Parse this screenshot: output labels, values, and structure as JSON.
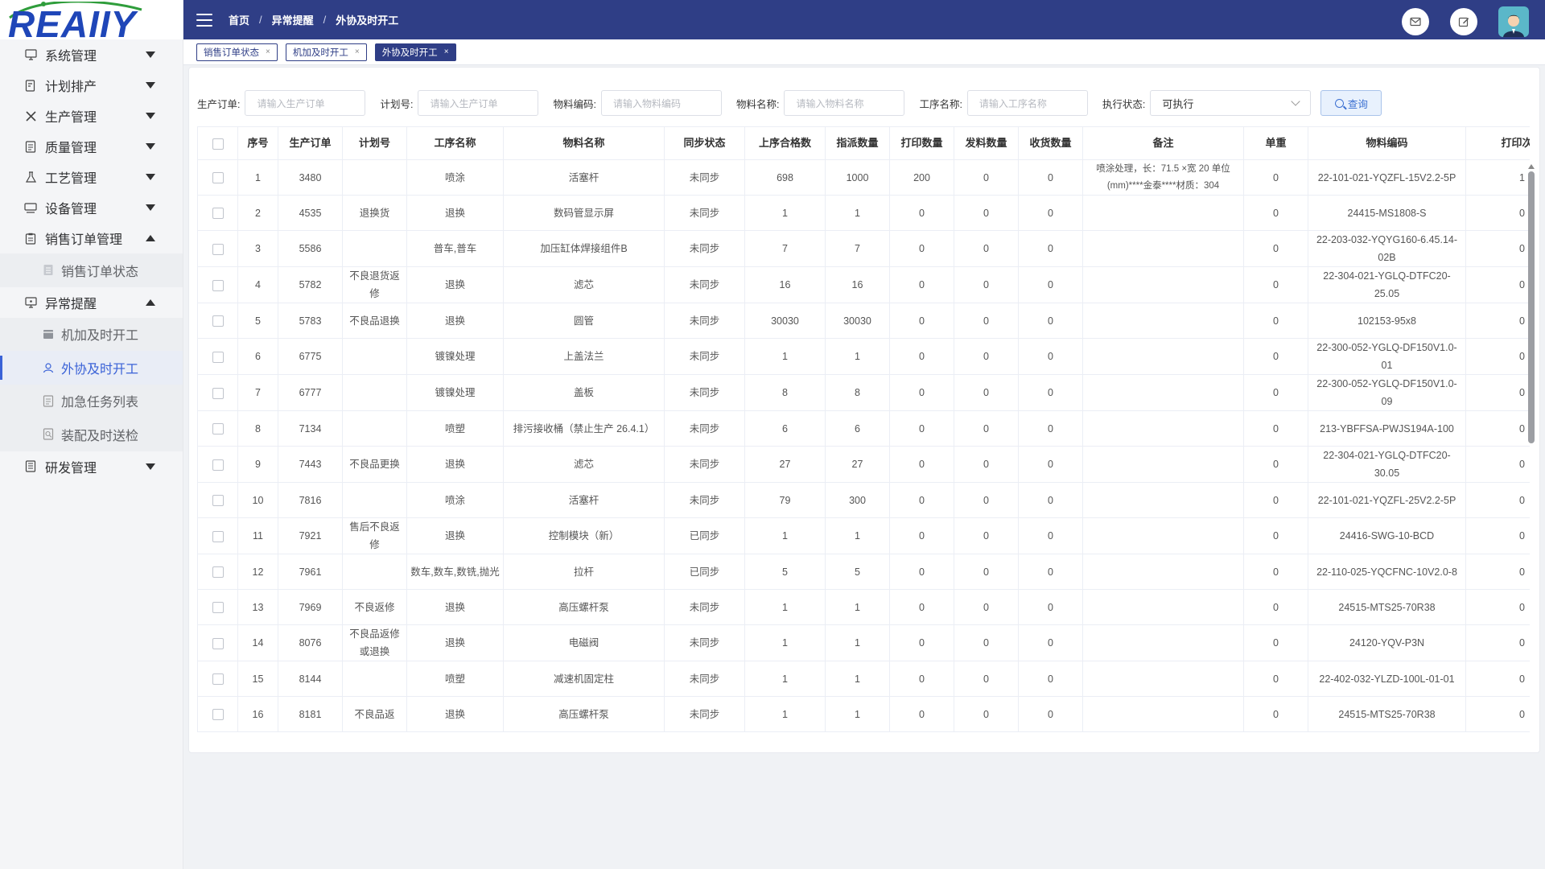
{
  "logo": {
    "text": "REAIIY"
  },
  "sidebar": {
    "items": [
      {
        "label": "系统管理",
        "icon": "monitor-icon",
        "expanded": false
      },
      {
        "label": "计划排产",
        "icon": "document-edit-icon",
        "expanded": false
      },
      {
        "label": "生产管理",
        "icon": "tools-icon",
        "expanded": false
      },
      {
        "label": "质量管理",
        "icon": "document-icon",
        "expanded": false
      },
      {
        "label": "工艺管理",
        "icon": "flask-icon",
        "expanded": false
      },
      {
        "label": "设备管理",
        "icon": "device-icon",
        "expanded": false
      },
      {
        "label": "销售订单管理",
        "icon": "clipboard-icon",
        "expanded": true,
        "children": [
          {
            "label": "销售订单状态",
            "icon": "list-icon"
          }
        ]
      },
      {
        "label": "异常提醒",
        "icon": "monitor-alert-icon",
        "expanded": true,
        "children": [
          {
            "label": "机加及时开工",
            "icon": "calendar-icon"
          },
          {
            "label": "外协及时开工",
            "icon": "user-icon",
            "active": true
          },
          {
            "label": "加急任务列表",
            "icon": "doc-list-icon"
          },
          {
            "label": "装配及时送检",
            "icon": "inspect-icon"
          }
        ]
      },
      {
        "label": "研发管理",
        "icon": "notebook-icon",
        "expanded": false
      }
    ]
  },
  "header": {
    "breadcrumb": [
      "首页",
      "异常提醒",
      "外协及时开工"
    ],
    "breadcrumb_sep": "/"
  },
  "tabs": [
    {
      "label": "销售订单状态",
      "active": false
    },
    {
      "label": "机加及时开工",
      "active": false
    },
    {
      "label": "外协及时开工",
      "active": true
    }
  ],
  "filters": {
    "production_order": {
      "label": "生产订单:",
      "placeholder": "请输入生产订单"
    },
    "plan_no": {
      "label": "计划号:",
      "placeholder": "请输入生产订单"
    },
    "material_code": {
      "label": "物料编码:",
      "placeholder": "请输入物料编码"
    },
    "material_name": {
      "label": "物料名称:",
      "placeholder": "请输入物料名称"
    },
    "process_name": {
      "label": "工序名称:",
      "placeholder": "请输入工序名称"
    },
    "exec_status": {
      "label": "执行状态:",
      "value": "可执行"
    },
    "query_label": "查询"
  },
  "table": {
    "columns": [
      "",
      "序号",
      "生产订单",
      "计划号",
      "工序名称",
      "物料名称",
      "同步状态",
      "上序合格数",
      "指派数量",
      "打印数量",
      "发料数量",
      "收货数量",
      "备注",
      "单重",
      "物料编码",
      "打印次数"
    ],
    "rows": [
      [
        "1",
        "3480",
        "",
        "喷涂",
        "活塞杆",
        "未同步",
        "698",
        "1000",
        "200",
        "0",
        "0",
        "喷涂处理，长：71.5 ×宽 20 单位(mm)****金泰****材质：304",
        "0",
        "22-101-021-YQZFL-15V2.2-5P",
        "1"
      ],
      [
        "2",
        "4535",
        "退换货",
        "退换",
        "数码管显示屏",
        "未同步",
        "1",
        "1",
        "0",
        "0",
        "0",
        "",
        "0",
        "24415-MS1808-S",
        "0"
      ],
      [
        "3",
        "5586",
        "",
        "普车,普车",
        "加压缸体焊接组件B",
        "未同步",
        "7",
        "7",
        "0",
        "0",
        "0",
        "",
        "0",
        "22-203-032-YQYG160-6.45.14-02B",
        "0"
      ],
      [
        "4",
        "5782",
        "不良退货返修",
        "退换",
        "滤芯",
        "未同步",
        "16",
        "16",
        "0",
        "0",
        "0",
        "",
        "0",
        "22-304-021-YGLQ-DTFC20-25.05",
        "0"
      ],
      [
        "5",
        "5783",
        "不良品退换",
        "退换",
        "圆管",
        "未同步",
        "30030",
        "30030",
        "0",
        "0",
        "0",
        "",
        "0",
        "102153-95x8",
        "0"
      ],
      [
        "6",
        "6775",
        "",
        "镀镍处理",
        "上盖法兰",
        "未同步",
        "1",
        "1",
        "0",
        "0",
        "0",
        "",
        "0",
        "22-300-052-YGLQ-DF150V1.0-01",
        "0"
      ],
      [
        "7",
        "6777",
        "",
        "镀镍处理",
        "盖板",
        "未同步",
        "8",
        "8",
        "0",
        "0",
        "0",
        "",
        "0",
        "22-300-052-YGLQ-DF150V1.0-09",
        "0"
      ],
      [
        "8",
        "7134",
        "",
        "喷塑",
        "排污接收桶（禁止生产 26.4.1）",
        "未同步",
        "6",
        "6",
        "0",
        "0",
        "0",
        "",
        "0",
        "213-YBFFSA-PWJS194A-100",
        "0"
      ],
      [
        "9",
        "7443",
        "不良品更换",
        "退换",
        "滤芯",
        "未同步",
        "27",
        "27",
        "0",
        "0",
        "0",
        "",
        "0",
        "22-304-021-YGLQ-DTFC20-30.05",
        "0"
      ],
      [
        "10",
        "7816",
        "",
        "喷涂",
        "活塞杆",
        "未同步",
        "79",
        "300",
        "0",
        "0",
        "0",
        "",
        "0",
        "22-101-021-YQZFL-25V2.2-5P",
        "0"
      ],
      [
        "11",
        "7921",
        "售后不良返修",
        "退换",
        "控制模块（新）",
        "已同步",
        "1",
        "1",
        "0",
        "0",
        "0",
        "",
        "0",
        "24416-SWG-10-BCD",
        "0"
      ],
      [
        "12",
        "7961",
        "",
        "数车,数车,数铣,抛光",
        "拉杆",
        "已同步",
        "5",
        "5",
        "0",
        "0",
        "0",
        "",
        "0",
        "22-110-025-YQCFNC-10V2.0-8",
        "0"
      ],
      [
        "13",
        "7969",
        "不良返修",
        "退换",
        "高压螺杆泵",
        "未同步",
        "1",
        "1",
        "0",
        "0",
        "0",
        "",
        "0",
        "24515-MTS25-70R38",
        "0"
      ],
      [
        "14",
        "8076",
        "不良品返修或退换",
        "退换",
        "电磁阀",
        "未同步",
        "1",
        "1",
        "0",
        "0",
        "0",
        "",
        "0",
        "24120-YQV-P3N",
        "0"
      ],
      [
        "15",
        "8144",
        "",
        "喷塑",
        "减速机固定柱",
        "未同步",
        "1",
        "1",
        "0",
        "0",
        "0",
        "",
        "0",
        "22-402-032-YLZD-100L-01-01",
        "0"
      ],
      [
        "16",
        "8181",
        "不良品返",
        "退换",
        "高压螺杆泵",
        "未同步",
        "1",
        "1",
        "0",
        "0",
        "0",
        "",
        "0",
        "24515-MTS25-70R38",
        "0"
      ]
    ]
  },
  "colors": {
    "header_bg": "#2f3e86",
    "accent": "#3a62d7",
    "logo_blue": "#1f46b8",
    "logo_green": "#2f9d3b"
  }
}
